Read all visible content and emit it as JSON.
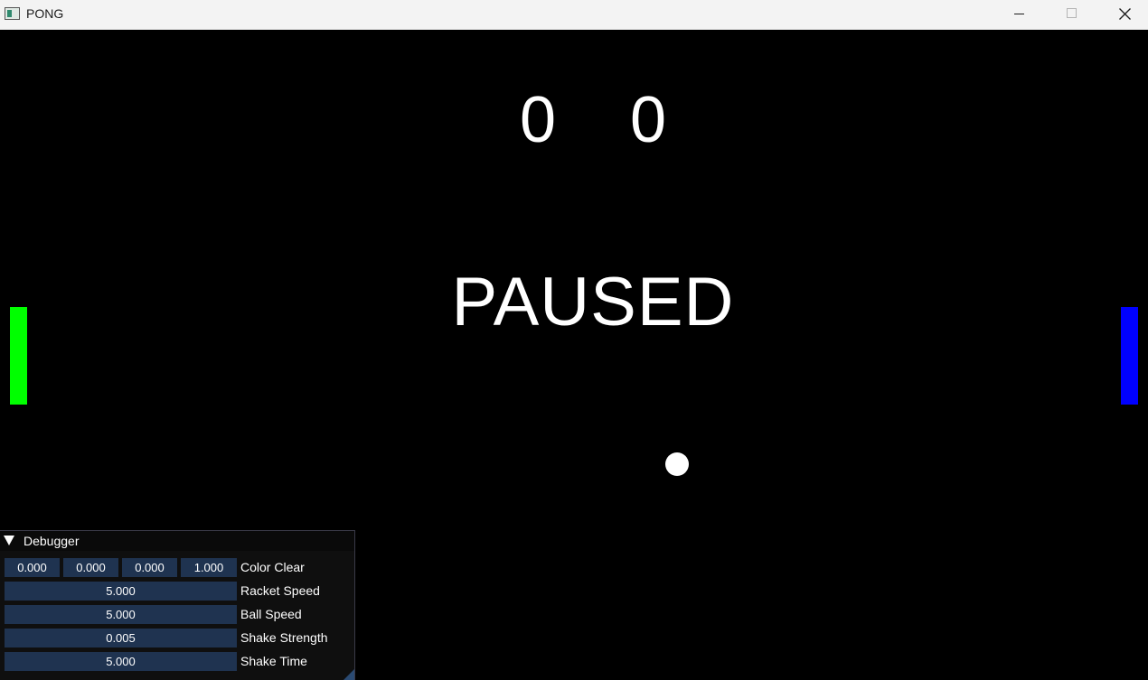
{
  "window": {
    "title": "PONG",
    "icon": "app-window-icon",
    "controls": [
      "minimize-icon",
      "maximize-icon",
      "close-icon"
    ]
  },
  "game": {
    "score_left": "0",
    "score_right": "0",
    "status": "PAUSED",
    "colors": {
      "background": "#000000",
      "left_paddle": "#00ff00",
      "right_paddle": "#0000ff",
      "ball": "#ffffff"
    }
  },
  "debugger": {
    "title": "Debugger",
    "collapse_icon": "triangle-down-icon",
    "color_clear": {
      "label": "Color Clear",
      "values": [
        "0.000",
        "0.000",
        "0.000",
        "1.000"
      ]
    },
    "racket_speed": {
      "label": "Racket Speed",
      "value": "5.000"
    },
    "ball_speed": {
      "label": "Ball Speed",
      "value": "5.000"
    },
    "shake_strength": {
      "label": "Shake Strength",
      "value": "0.005"
    },
    "shake_time": {
      "label": "Shake Time",
      "value": "5.000"
    }
  }
}
